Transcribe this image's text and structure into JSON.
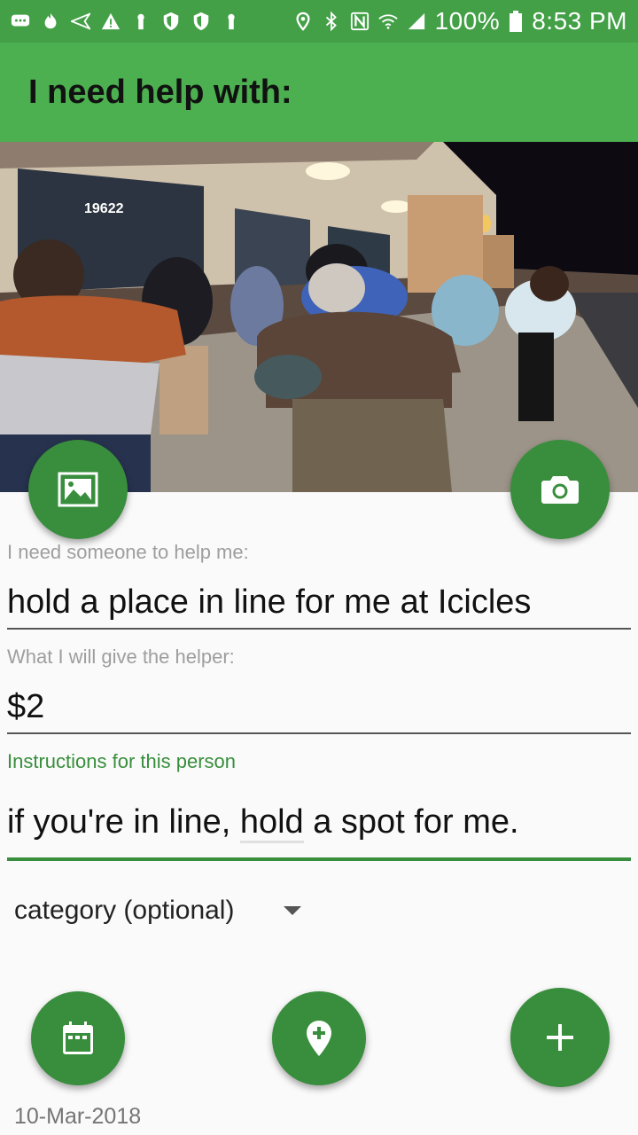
{
  "status_bar": {
    "battery": "100%",
    "time": "8:53 PM"
  },
  "app_bar": {
    "title": "I need help with:"
  },
  "form": {
    "help_field": {
      "label": "I need someone to help me:",
      "value": "hold a place in line for me at Icicles"
    },
    "give_field": {
      "label": "What I will give the helper:",
      "value": "$2"
    },
    "instructions_field": {
      "label": "Instructions for this person",
      "value_before": "if you're in line, ",
      "value_misspelled": "hold",
      "value_after": " a spot for me."
    },
    "category": {
      "selected": "category (optional)"
    },
    "date": "10-Mar-2018"
  },
  "colors": {
    "status_bar": "#43a047",
    "app_bar": "#4caf50",
    "fab": "#388e3c",
    "accent": "#388e3c"
  },
  "icons": {
    "gallery_button": "image-icon",
    "camera_button": "camera-icon",
    "date_button": "calendar-icon",
    "location_button": "add-location-icon",
    "submit_button": "add-icon"
  }
}
